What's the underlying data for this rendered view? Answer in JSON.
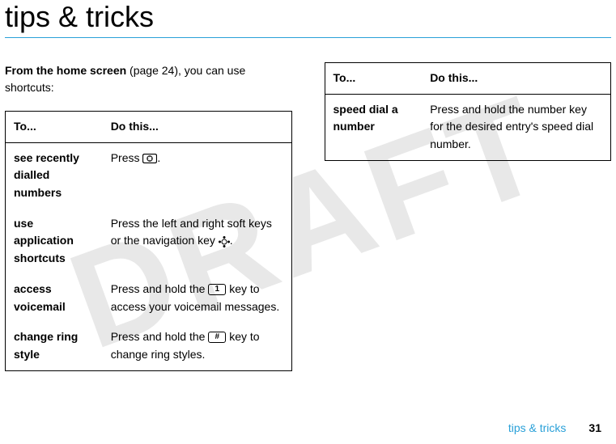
{
  "watermark": "DRAFT",
  "title": "tips & tricks",
  "intro": {
    "bold": "From the home screen",
    "rest": " (page 24), you can use shortcuts:"
  },
  "table1": {
    "headers": {
      "c1": "To...",
      "c2": "Do this..."
    },
    "rows": [
      {
        "label": "see recently dialled numbers",
        "pre": "Press ",
        "key_type": "send",
        "post": "."
      },
      {
        "label": "use application shortcuts",
        "pre": "Press the left and right soft keys or the navigation key ",
        "key_type": "nav",
        "post": "."
      },
      {
        "label": "access voicemail",
        "pre": "Press and hold the ",
        "key_type": "box",
        "key_text": "1",
        "post": " key to access your voicemail messages."
      },
      {
        "label": "change ring style",
        "pre": "Press and hold the ",
        "key_type": "box",
        "key_text": "#",
        "post": " key to change ring styles."
      }
    ]
  },
  "table2": {
    "headers": {
      "c1": "To...",
      "c2": "Do this..."
    },
    "rows": [
      {
        "label": "speed dial a number",
        "text": "Press and hold the number key for the desired entry's speed dial number."
      }
    ]
  },
  "footer": {
    "link": "tips & tricks",
    "page": "31"
  }
}
